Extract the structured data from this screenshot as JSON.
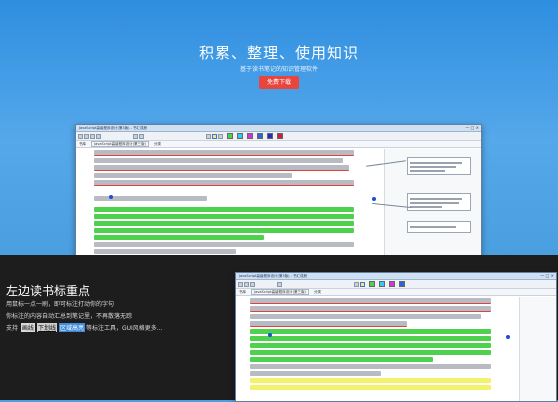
{
  "hero": {
    "title": "积累、整理、使用知识",
    "subtitle": "基于读书笔记的知识管理软件",
    "download_label": "免费下载"
  },
  "app_window": {
    "title": "JavaScript高级程序设计(第3版) - 书汇成册",
    "tabs": [
      "书库",
      "JavaScript高级程序设计(第三版)",
      "分类"
    ],
    "win_controls": "— □ ×",
    "highlight_colors": [
      "#4ed24e",
      "#33c9f2",
      "#d633d6",
      "#2f63d8",
      "#2b2bb8",
      "#d8183c"
    ]
  },
  "lower": {
    "title": "左边读书标重点",
    "lines": [
      "用鼠标一点一刷，即可标注打动你的字句",
      "你标注的内容自动汇总到笔记里，不再散落无踪",
      "支持 ",
      "，GUI风格更多..."
    ],
    "chips": [
      "画线",
      "下划线",
      "区域高亮",
      "等标注工具"
    ]
  }
}
